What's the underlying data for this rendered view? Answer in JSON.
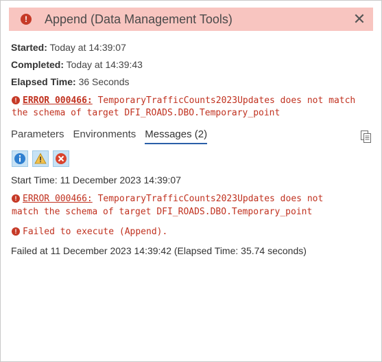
{
  "header": {
    "title": "Append (Data Management Tools)",
    "close_glyph": "✕",
    "error_glyph": "!"
  },
  "summary": {
    "started_label": "Started:",
    "started_value": "Today at 14:39:07",
    "completed_label": "Completed:",
    "completed_value": "Today at 14:39:43",
    "elapsed_label": "Elapsed Time:",
    "elapsed_value": "36 Seconds",
    "error_code": "ERROR 000466:",
    "error_text_1": " TemporaryTrafficCounts2023Updates does not match",
    "error_text_2": "the schema of target DFI_ROADS.DBO.Temporary_point"
  },
  "tabs": [
    {
      "label": "Parameters"
    },
    {
      "label": "Environments"
    },
    {
      "label": "Messages (2)"
    }
  ],
  "icons": {
    "copy": "copy-icon",
    "info": "info-icon",
    "warning": "warning-icon",
    "error": "error-icon"
  },
  "messages": {
    "start": "Start Time: 11 December 2023 14:39:07",
    "error_code": "ERROR 000466:",
    "error_text_1": " TemporaryTrafficCounts2023Updates does not",
    "error_text_2": "match the schema of target DFI_ROADS.DBO.Temporary_point",
    "failed_execute": "Failed to execute (Append).",
    "failed_at": "Failed at 11 December 2023 14:39:42 (Elapsed Time: 35.74 seconds)"
  },
  "colors": {
    "header_bg": "#f8c5c0",
    "error_red": "#c0311f",
    "tab_underline": "#2a5fa8",
    "filter_bg": "#c7e2f5"
  }
}
